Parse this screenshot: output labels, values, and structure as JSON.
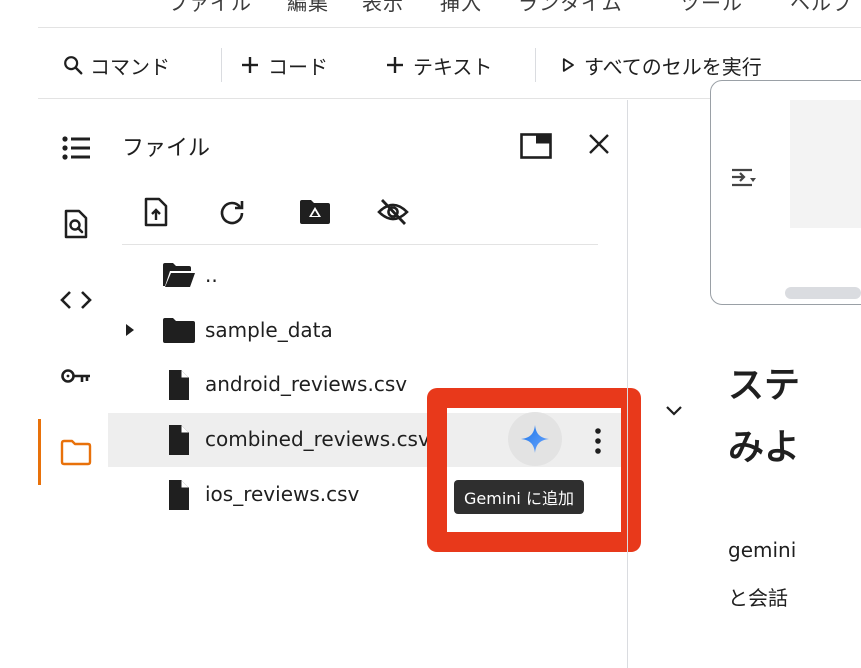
{
  "menubar": {
    "items": [
      "ファイル",
      "編集",
      "表示",
      "挿入",
      "ランタイム",
      "ツール",
      "ヘルプ"
    ]
  },
  "toolbar": {
    "command_label": "コマンド",
    "add_code_label": "コード",
    "add_text_label": "テキスト",
    "run_all_label": "すべてのセルを実行"
  },
  "file_panel": {
    "title": "ファイル",
    "parent_dir": "..",
    "items": [
      {
        "name": "sample_data",
        "type": "folder"
      },
      {
        "name": "android_reviews.csv",
        "type": "file"
      },
      {
        "name": "combined_reviews.csv",
        "type": "file"
      },
      {
        "name": "ios_reviews.csv",
        "type": "file"
      }
    ],
    "tooltip": "Gemini に追加"
  },
  "notebook": {
    "heading_line1": "ステ",
    "heading_line2": "みよ",
    "para_line1": "gemini",
    "para_line2": "と会話"
  },
  "colors": {
    "accent_orange": "#e8710a",
    "highlight_red": "#e8391b",
    "gemini_blue": "#4285f4"
  },
  "icons": [
    "search-icon",
    "plus-icon",
    "play-icon",
    "toc-icon",
    "find-icon",
    "code-icon",
    "key-icon",
    "folder-icon",
    "maximize-icon",
    "close-icon",
    "upload-icon",
    "refresh-icon",
    "drive-icon",
    "hide-icon",
    "open-folder-icon",
    "file-icon",
    "chevron-right-icon",
    "chevron-down-icon",
    "gemini-sparkle-icon",
    "more-vert-icon",
    "output-icon"
  ]
}
